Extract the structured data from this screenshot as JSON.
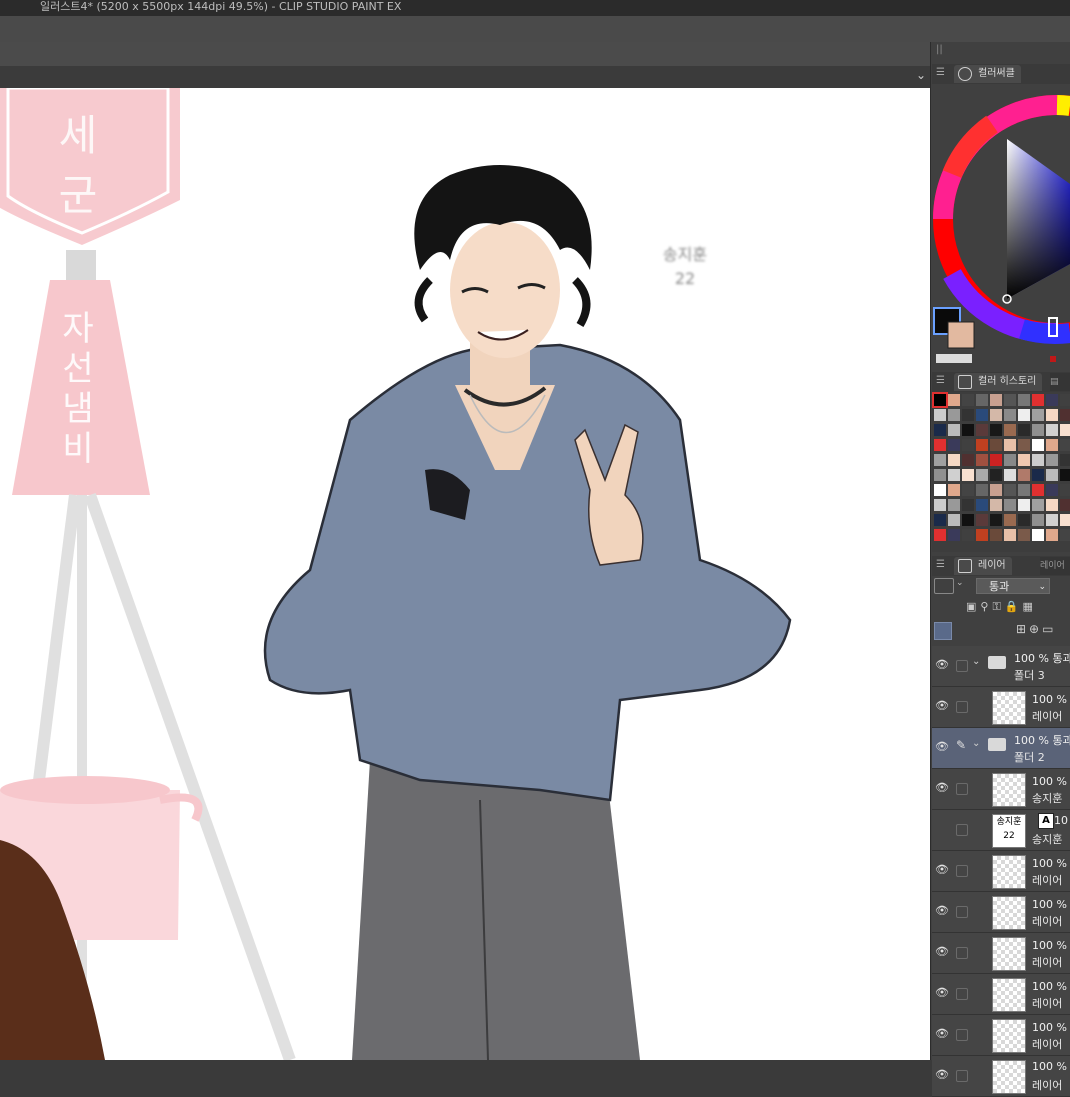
{
  "window": {
    "title": "일러스트4* (5200 x 5500px 144dpi 49.5%)  - CLIP STUDIO PAINT EX"
  },
  "canvas": {
    "sign_top_text": "세군",
    "sign_bottom_text": [
      "자",
      "선",
      "냄",
      "비"
    ],
    "signature_line1": "송지훈",
    "signature_line2": "22"
  },
  "panels": {
    "color_wheel_tab": "컬러써클",
    "color_history_tab": "컬러 히스토리",
    "layer_tab": "레이어",
    "layer_tab2": "레이어",
    "main_color": "#0a0a0a",
    "sub_color": "#e2b9a0"
  },
  "layer_panel": {
    "blend_mode": "통과",
    "layers": [
      {
        "line1": "100 % 통과",
        "line2": "폴더 3",
        "type": "folder",
        "selected": false
      },
      {
        "line1": "100 % 표",
        "line2": "레이어",
        "type": "layer",
        "selected": false
      },
      {
        "line1": "100 % 통과",
        "line2": "폴더 2",
        "type": "folder",
        "selected": true
      },
      {
        "line1": "100 % 표",
        "line2": "송지훈",
        "type": "layer",
        "selected": false
      },
      {
        "line1": "10",
        "line2": "송지훈",
        "type": "text",
        "selected": false,
        "badge": "A",
        "thumb_text1": "송지훈",
        "thumb_text2": "22"
      },
      {
        "line1": "100 % 표",
        "line2": "레이어",
        "type": "layer",
        "selected": false
      },
      {
        "line1": "100 % 표",
        "line2": "레이어",
        "type": "layer",
        "selected": false
      },
      {
        "line1": "100 % 표",
        "line2": "레이어",
        "type": "layer",
        "selected": false
      },
      {
        "line1": "100 % 표",
        "line2": "레이어",
        "type": "layer",
        "selected": false
      },
      {
        "line1": "100 % 표",
        "line2": "레이어",
        "type": "layer",
        "selected": false
      },
      {
        "line1": "100 %",
        "line2": "레이어",
        "type": "layer",
        "selected": false
      }
    ]
  },
  "history_colors": [
    "#ffffff",
    "#888",
    "#aaa",
    "#e0a88c",
    "#f0c8b0",
    "#222",
    "#444",
    "#ccc",
    "#ddd",
    "#666",
    "#999",
    "#b07a6a",
    "#c8a090",
    "#333",
    "#1a2a4a",
    "#555",
    "#2a4a7a",
    "#bbb",
    "#777",
    "#d4b8a8",
    "#111",
    "#e03030",
    "#8a8a8a",
    "#5a3a3a",
    "#3a3a5a",
    "#eee",
    "#181818",
    "#404040",
    "#a0a0a0",
    "#9a6a50",
    "#c04020",
    "#f4d8c4",
    "#2a2a2a",
    "#6a4a3a",
    "#503030",
    "#909090",
    "#e8c0a8",
    "#a05040",
    "#d0d0d0",
    "#7a5a4a",
    "#cc2222",
    "#f8e0d0"
  ]
}
